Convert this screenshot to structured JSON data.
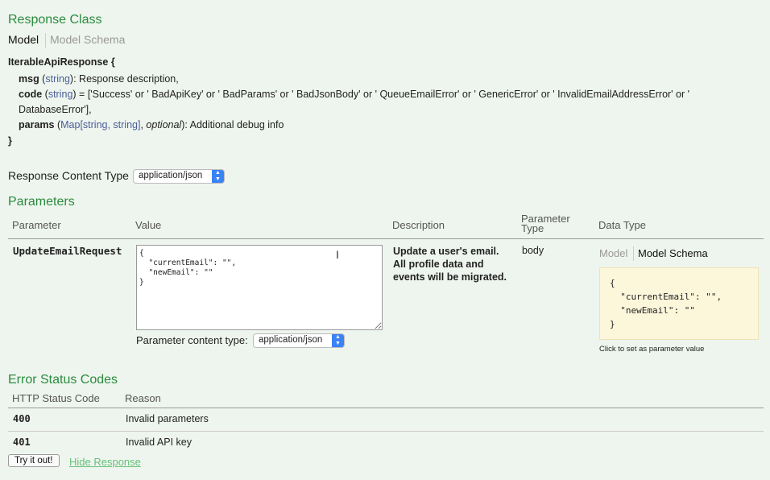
{
  "response_class": {
    "heading": "Response Class",
    "tabs": {
      "model": "Model",
      "schema": "Model Schema"
    },
    "model_name": "IterableApiResponse {",
    "fields": [
      {
        "name": "msg",
        "type": "string",
        "rest": ": Response description,"
      },
      {
        "name": "code",
        "type": "string",
        "rest": " = ['Success' or ' BadApiKey' or ' BadParams' or ' BadJsonBody' or ' QueueEmailError' or ' GenericError' or ' InvalidEmailAddressError' or '",
        "cont": "DatabaseError'],"
      },
      {
        "name": "params",
        "type": "Map[string, string]",
        "optional": "optional",
        "rest": "): Additional debug info"
      }
    ],
    "close_brace": "}"
  },
  "response_content_type": {
    "label": "Response Content Type",
    "value": "application/json"
  },
  "parameters": {
    "heading": "Parameters",
    "headers": {
      "parameter": "Parameter",
      "value": "Value",
      "description": "Description",
      "param_type_1": "Parameter",
      "param_type_2": "Type",
      "data_type": "Data Type"
    },
    "rows": [
      {
        "name": "UpdateEmailRequest",
        "value": "{\n  \"currentEmail\": \"\",\n  \"newEmail\": \"\"\n}",
        "description": "Update a user's email. All profile data and events will be migrated.",
        "param_type": "body",
        "data_type_tabs": {
          "model": "Model",
          "schema": "Model Schema"
        },
        "schema": "{\n  \"currentEmail\": \"\",\n  \"newEmail\": \"\"\n}",
        "hint": "Click to set as parameter value",
        "content_type_label": "Parameter content type:",
        "content_type_value": "application/json"
      }
    ]
  },
  "errors": {
    "heading": "Error Status Codes",
    "headers": {
      "code": "HTTP Status Code",
      "reason": "Reason"
    },
    "rows": [
      {
        "code": "400",
        "reason": "Invalid parameters"
      },
      {
        "code": "401",
        "reason": "Invalid API key"
      }
    ]
  },
  "actions": {
    "try_label": "Try it out!",
    "hide_label": "Hide Response"
  },
  "colors": {
    "heading": "#2b8a3e",
    "background": "#eef5ee",
    "link": "#66c07a",
    "signature_bg": "#fcf6db"
  }
}
